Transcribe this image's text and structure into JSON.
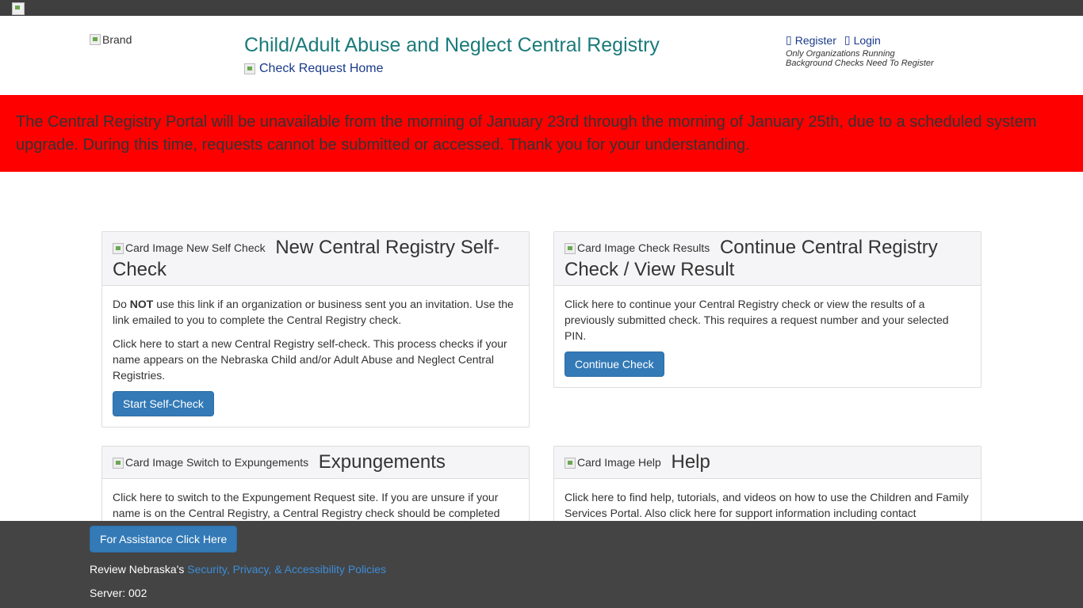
{
  "header": {
    "brand_alt": "Brand",
    "title": "Child/Adult Abuse and Neglect Central Registry",
    "home_link": "Check Request Home",
    "register": "Register",
    "login": "Login",
    "note_line1": "Only Organizations Running",
    "note_line2": "Background Checks Need To Register"
  },
  "alert": {
    "text": "The Central Registry Portal will be unavailable from the morning of January 23rd through the morning of January 25th, due to a scheduled system upgrade. During this time, requests cannot be submitted or accessed. Thank you for your understanding."
  },
  "cards": {
    "self_check": {
      "img_alt": "Card Image New Self Check",
      "title": "New Central Registry Self-Check",
      "p1_pre": "Do ",
      "p1_bold": "NOT",
      "p1_post": " use this link if an organization or business sent you an invitation. Use the link emailed to you to complete the Central Registry check.",
      "p2": "Click here to start a new Central Registry self-check. This process checks if your name appears on the Nebraska Child and/or Adult Abuse and Neglect Central Registries.",
      "button": "Start Self-Check"
    },
    "continue": {
      "img_alt": "Card Image Check Results",
      "title": "Continue Central Registry Check / View Result",
      "p1": "Click here to continue your Central Registry check or view the results of a previously submitted check. This requires a request number and your selected PIN.",
      "button": "Continue Check"
    },
    "expungements": {
      "img_alt": "Card Image Switch to Expungements",
      "title": "Expungements",
      "p1": "Click here to switch to the Expungement Request site. If you are unsure if your name is on the Central Registry, a Central Registry check should be completed"
    },
    "help": {
      "img_alt": "Card Image Help",
      "title": "Help",
      "p1": "Click here to find help, tutorials, and videos on how to use the Children and Family Services Portal. Also click here for support information including contact"
    }
  },
  "footer": {
    "assist_button": "For Assistance Click Here",
    "policy_pre": "Review Nebraska's ",
    "policy_link": "Security, Privacy, & Accessibility Policies",
    "server": "Server: 002"
  }
}
